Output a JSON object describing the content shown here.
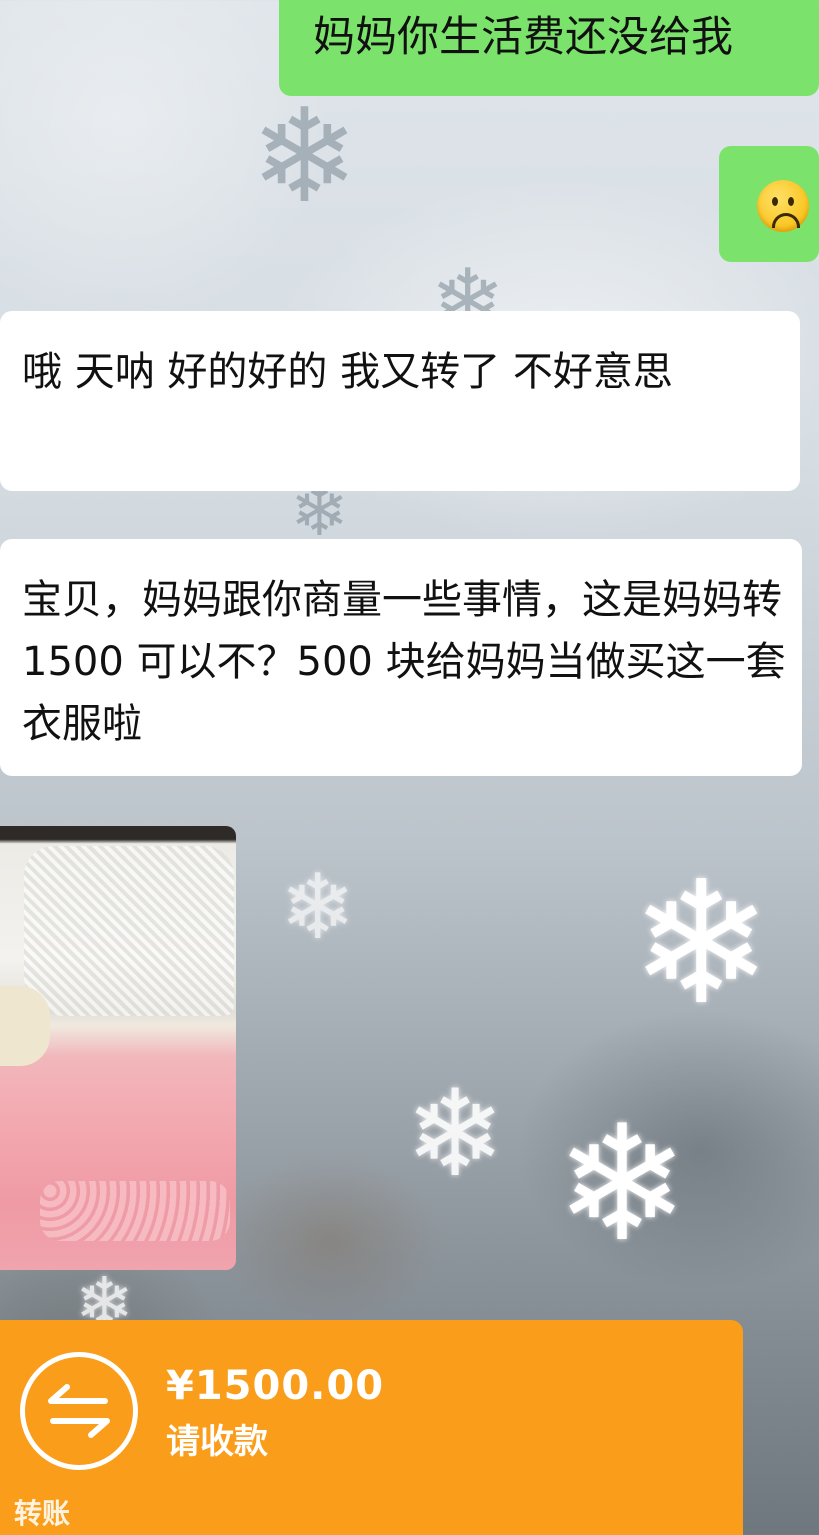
{
  "messages": {
    "msg1": "妈妈你生活费还没给我",
    "msg2_emoji": "sad-face",
    "msg3": "哦 天呐 好的好的 我又转了 不好意思",
    "msg4": "宝贝，妈妈跟你商量一些事情，这是妈妈转 1500 可以不？500 块给妈妈当做买这一套衣服啦"
  },
  "transfer": {
    "amount": "¥1500.00",
    "status": "请收款",
    "footer": "转账",
    "color": "#fa9d1a"
  },
  "colors": {
    "sent_bubble": "#7be36b",
    "received_bubble": "#ffffff"
  },
  "decor": {
    "snowflake": "❄"
  }
}
